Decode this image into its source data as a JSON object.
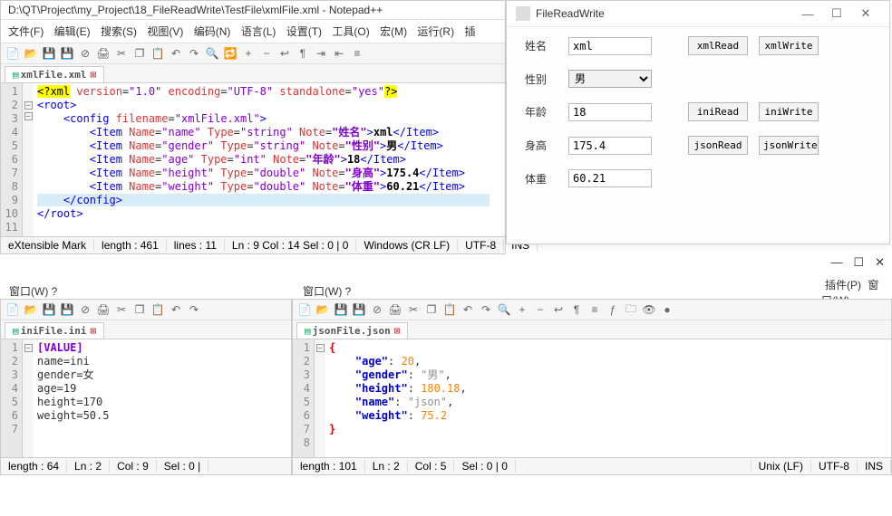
{
  "npp_main": {
    "title": "D:\\QT\\Project\\my_Project\\18_FileReadWrite\\TestFile\\xmlFile.xml - Notepad++",
    "menu": [
      "文件(F)",
      "编辑(E)",
      "搜索(S)",
      "视图(V)",
      "编码(N)",
      "语言(L)",
      "设置(T)",
      "工具(O)",
      "宏(M)",
      "运行(R)",
      "插"
    ],
    "tab": "xmlFile.xml",
    "status": {
      "type": "eXtensible Mark",
      "length": "length : 461",
      "lines": "lines : 11",
      "pos": "Ln : 9   Col : 14   Sel : 0 | 0",
      "eol": "Windows (CR LF)",
      "enc": "UTF-8",
      "ins": "INS"
    }
  },
  "xml_lines": {
    "l1_pi": "<?xml",
    "l1_v": " version",
    "l1_vv": "\"1.0\"",
    "l1_e": " encoding",
    "l1_ev": "\"UTF-8\"",
    "l1_s": " standalone",
    "l1_sv": "\"yes\"",
    "l1_end": "?>",
    "root_o": "<root>",
    "config_o": "<config",
    "fn": " filename",
    "fnv": "\"xmlFile.xml\"",
    "gt": ">",
    "item": "<Item",
    "item_c": "</Item>",
    "name_a": " Name",
    "type_a": " Type",
    "note_a": " Note",
    "eq": "=",
    "i1_name": "\"name\"",
    "i1_type": "\"string\"",
    "i1_note": "\"姓名\"",
    "i1_txt": "xml",
    "i2_name": "\"gender\"",
    "i2_type": "\"string\"",
    "i2_note": "\"性别\"",
    "i2_txt": "男",
    "i3_name": "\"age\"",
    "i3_type": "\"int\"",
    "i3_note": "\"年龄\"",
    "i3_txt": "18",
    "i4_name": "\"height\"",
    "i4_type": "\"double\"",
    "i4_note": "\"身高\"",
    "i4_txt": "175.4",
    "i5_name": "\"weight\"",
    "i5_type": "\"double\"",
    "i5_note": "\"体重\"",
    "i5_txt": "60.21",
    "config_c": "</config>",
    "root_c": "</root>"
  },
  "qt": {
    "title": "FileReadWrite",
    "rows": [
      {
        "label": "姓名",
        "value": "xml"
      },
      {
        "label": "性别",
        "value": "男"
      },
      {
        "label": "年龄",
        "value": "18"
      },
      {
        "label": "身高",
        "value": "175.4"
      },
      {
        "label": "体重",
        "value": "60.21"
      }
    ],
    "buttons": [
      "xmlRead",
      "xmlWrite",
      "iniRead",
      "iniWrite",
      "jsonRead",
      "jsonWrite"
    ]
  },
  "right_stub": {
    "menu": [
      "插件(P)",
      "窗口(W)"
    ]
  },
  "window_menu": {
    "left": "窗口(W)   ?",
    "right": "窗口(W)   ?"
  },
  "ini_pane": {
    "tab": "iniFile.ini",
    "lines": {
      "section": "[VALUE]",
      "name": "name=ini",
      "gender": "gender=女",
      "age": "age=19",
      "height": "height=170",
      "weight": "weight=50.5"
    },
    "status": {
      "length": "length : 64",
      "ln": "Ln : 2",
      "col": "Col : 9",
      "sel": "Sel : 0 |"
    }
  },
  "json_pane": {
    "tab": "jsonFile.json",
    "lines": {
      "age_k": "\"age\"",
      "age_v": "20",
      "gender_k": "\"gender\"",
      "gender_v": "\"男\"",
      "height_k": "\"height\"",
      "height_v": "180.18",
      "name_k": "\"name\"",
      "name_v": "\"json\"",
      "weight_k": "\"weight\"",
      "weight_v": "75.2"
    },
    "status": {
      "length": "length : 101",
      "ln": "Ln : 2",
      "col": "Col : 5",
      "sel": "Sel : 0 | 0",
      "eol": "Unix (LF)",
      "enc": "UTF-8",
      "ins": "INS"
    }
  }
}
